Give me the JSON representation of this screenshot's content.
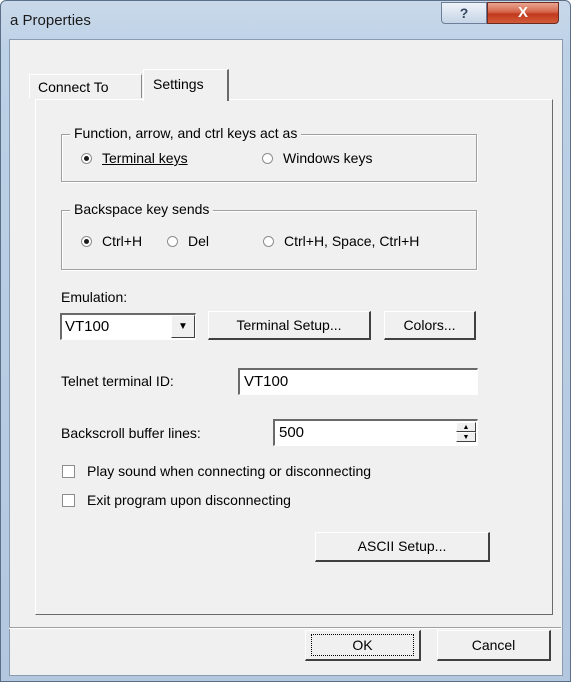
{
  "window": {
    "title": "a Properties",
    "help_glyph": "?",
    "close_glyph": "X"
  },
  "tabs": [
    {
      "label": "Connect To"
    },
    {
      "label": "Settings"
    }
  ],
  "keys_group": {
    "legend": "Function, arrow, and ctrl keys act as",
    "options": [
      {
        "label": "Terminal keys",
        "checked": true
      },
      {
        "label": "Windows keys",
        "checked": false
      }
    ]
  },
  "backspace_group": {
    "legend": "Backspace key sends",
    "options": [
      {
        "label": "Ctrl+H",
        "checked": true
      },
      {
        "label": "Del",
        "checked": false
      },
      {
        "label": "Ctrl+H, Space, Ctrl+H",
        "checked": false
      }
    ]
  },
  "emulation": {
    "label": "Emulation:",
    "value": "VT100",
    "terminal_setup_label": "Terminal Setup...",
    "colors_label": "Colors..."
  },
  "telnet": {
    "label": "Telnet terminal ID:",
    "value": "VT100"
  },
  "backscroll": {
    "label": "Backscroll buffer lines:",
    "value": "500"
  },
  "checkboxes": [
    {
      "label": "Play sound when connecting or disconnecting",
      "checked": false
    },
    {
      "label": "Exit program upon disconnecting",
      "checked": false
    }
  ],
  "ascii_setup_label": "ASCII Setup...",
  "footer": {
    "ok_label": "OK",
    "cancel_label": "Cancel"
  }
}
